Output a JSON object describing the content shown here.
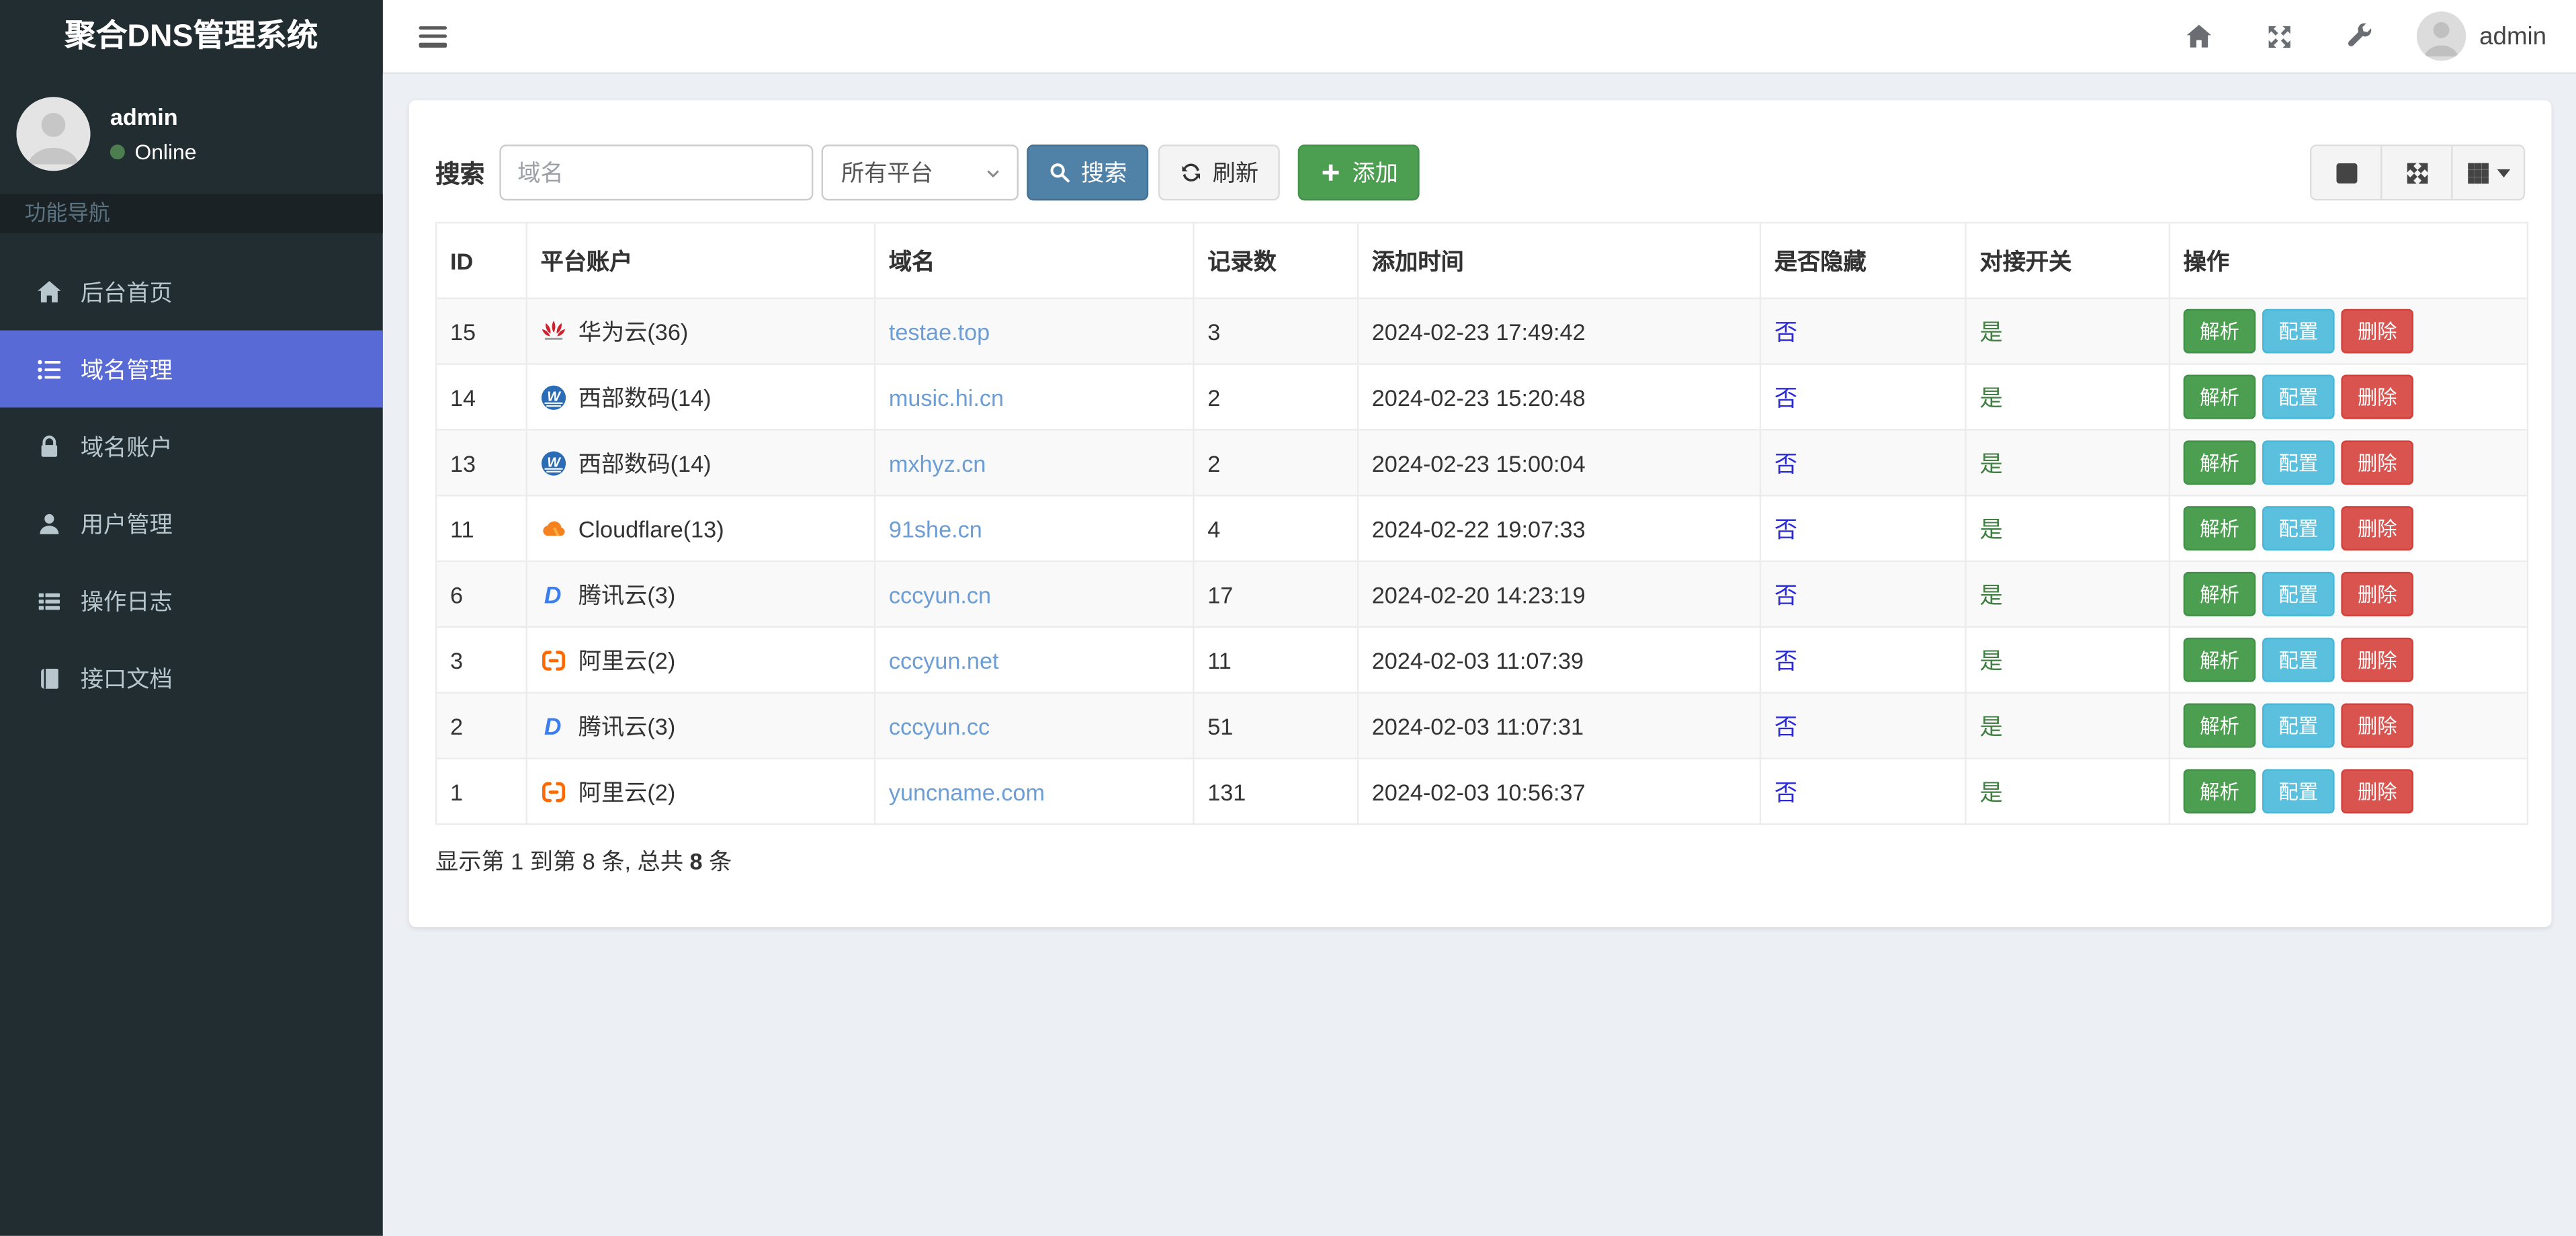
{
  "app": {
    "title": "聚合DNS管理系统"
  },
  "sidebar": {
    "user": {
      "name": "admin",
      "status": "Online"
    },
    "nav_header": "功能导航",
    "items": [
      {
        "key": "home",
        "label": "后台首页",
        "icon": "home-icon",
        "active": false
      },
      {
        "key": "domains",
        "label": "域名管理",
        "icon": "list-icon",
        "active": true
      },
      {
        "key": "accounts",
        "label": "域名账户",
        "icon": "lock-icon",
        "active": false
      },
      {
        "key": "users",
        "label": "用户管理",
        "icon": "user-icon",
        "active": false
      },
      {
        "key": "logs",
        "label": "操作日志",
        "icon": "log-icon",
        "active": false
      },
      {
        "key": "docs",
        "label": "接口文档",
        "icon": "book-icon",
        "active": false
      }
    ]
  },
  "topbar": {
    "user": "admin"
  },
  "toolbar": {
    "search_label": "搜索",
    "search_placeholder": "域名",
    "platform_select": "所有平台",
    "search_button": "搜索",
    "refresh_button": "刷新",
    "add_button": "添加"
  },
  "table": {
    "columns": [
      "ID",
      "平台账户",
      "域名",
      "记录数",
      "添加时间",
      "是否隐藏",
      "对接开关",
      "操作"
    ],
    "action_labels": {
      "resolve": "解析",
      "config": "配置",
      "delete": "删除"
    },
    "rows": [
      {
        "id": "15",
        "platform": "华为云(36)",
        "platform_icon": "huawei-icon",
        "domain": "testae.top",
        "records": "3",
        "added": "2024-02-23 17:49:42",
        "hidden": "否",
        "switch": "是"
      },
      {
        "id": "14",
        "platform": "西部数码(14)",
        "platform_icon": "west-icon",
        "domain": "music.hi.cn",
        "records": "2",
        "added": "2024-02-23 15:20:48",
        "hidden": "否",
        "switch": "是"
      },
      {
        "id": "13",
        "platform": "西部数码(14)",
        "platform_icon": "west-icon",
        "domain": "mxhyz.cn",
        "records": "2",
        "added": "2024-02-23 15:00:04",
        "hidden": "否",
        "switch": "是"
      },
      {
        "id": "11",
        "platform": "Cloudflare(13)",
        "platform_icon": "cloudflare-icon",
        "domain": "91she.cn",
        "records": "4",
        "added": "2024-02-22 19:07:33",
        "hidden": "否",
        "switch": "是"
      },
      {
        "id": "6",
        "platform": "腾讯云(3)",
        "platform_icon": "dnspod-icon",
        "domain": "cccyun.cn",
        "records": "17",
        "added": "2024-02-20 14:23:19",
        "hidden": "否",
        "switch": "是"
      },
      {
        "id": "3",
        "platform": "阿里云(2)",
        "platform_icon": "aliyun-icon",
        "domain": "cccyun.net",
        "records": "11",
        "added": "2024-02-03 11:07:39",
        "hidden": "否",
        "switch": "是"
      },
      {
        "id": "2",
        "platform": "腾讯云(3)",
        "platform_icon": "dnspod-icon",
        "domain": "cccyun.cc",
        "records": "51",
        "added": "2024-02-03 11:07:31",
        "hidden": "否",
        "switch": "是"
      },
      {
        "id": "1",
        "platform": "阿里云(2)",
        "platform_icon": "aliyun-icon",
        "domain": "yuncname.com",
        "records": "131",
        "added": "2024-02-03 10:56:37",
        "hidden": "否",
        "switch": "是"
      }
    ]
  },
  "pagination": {
    "prefix": "显示第 1 到第 8 条, 总共 ",
    "total": "8",
    "suffix": " 条"
  },
  "colors": {
    "sidebar_bg": "#222d32",
    "accent_active": "#586ad6",
    "content_bg": "#eceff4",
    "search_btn": "#5081a7",
    "add_btn": "#4c9e50",
    "info_btn": "#5bc0de",
    "danger_btn": "#d9534f",
    "domain_link": "#6c9dd4",
    "hidden_flag": "#2a2ad9",
    "switch_flag": "#417f42",
    "online_dot": "#4d7e50"
  }
}
